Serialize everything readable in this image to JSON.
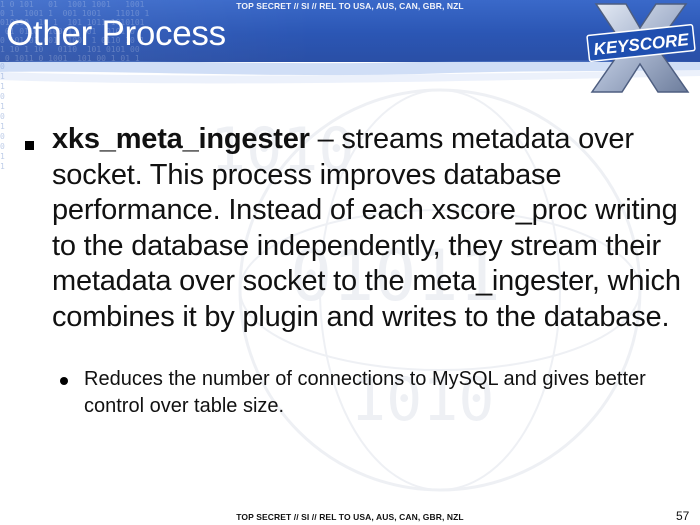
{
  "classification": {
    "top": "TOP SECRET // SI // REL TO USA, AUS, CAN, GBR, NZL",
    "bottom": "TOP SECRET // SI // REL TO USA, AUS, CAN, GBR, NZL"
  },
  "slide": {
    "title": "Other Process",
    "logo_text": "KEYSCORE",
    "page_number": "57"
  },
  "bullets": [
    {
      "keyword": "xks_meta_ingester",
      "text": " – streams metadata over socket. This process improves database performance. Instead of each xscore_proc writing to the database independently, they stream their metadata over socket to the meta_ingester, which combines it by plugin and writes to the database.",
      "sub_bullets": [
        "Reduces the number of connections to MySQL and gives better control over table size."
      ]
    }
  ],
  "colors": {
    "header_blue": "#2b56b4",
    "text": "#111111",
    "logo_blue": "#1f4fb0"
  },
  "icons": {
    "main_bullet": "square-bullet-icon",
    "sub_bullet": "round-bullet-icon",
    "logo": "keyscore-x-logo"
  }
}
